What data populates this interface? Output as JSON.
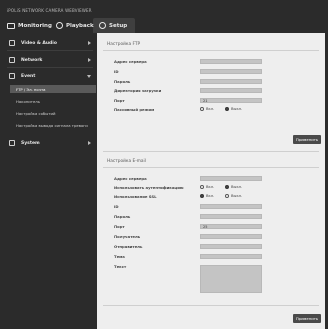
{
  "brand": "iPOLiS NETWORK CAMERA WEBVIEWER",
  "topnav": {
    "monitoring": "Monitoring",
    "playback": "Playback",
    "setup": "Setup"
  },
  "sidebar": {
    "items": [
      {
        "label": "Video & Audio"
      },
      {
        "label": "Network"
      },
      {
        "label": "Event"
      },
      {
        "label": "System"
      }
    ],
    "event_sub": [
      {
        "label": "FTP / Эл. почта"
      },
      {
        "label": "Накопитель"
      },
      {
        "label": "Настройка событий"
      },
      {
        "label": "Настройка вывода сигнала тревоги"
      }
    ]
  },
  "ftp": {
    "title": "Настройка FTP",
    "fields": [
      {
        "label": "Адрес сервера"
      },
      {
        "label": "ID"
      },
      {
        "label": "Пароль"
      },
      {
        "label": "Директория загрузки"
      },
      {
        "label": "Порт"
      }
    ],
    "port_value": "21",
    "passive_label": "Пассивный режим",
    "on_label": "Вкл.",
    "off_label": "Выкл.",
    "passive_selected": "off",
    "apply": "Применить"
  },
  "email": {
    "title": "Настройка E-mail",
    "server_label": "Адрес сервера",
    "auth_label": "Использовать аутентификацию",
    "ssl_label": "Использование SSL",
    "on_label": "Вкл.",
    "off_label": "Выкл.",
    "auth_selected": "off",
    "ssl_selected": "on",
    "id_label": "ID",
    "password_label": "Пароль",
    "port_label": "Порт",
    "port_value": "25",
    "recipient_label": "Получатель",
    "sender_label": "Отправитель",
    "subject_label": "Тема",
    "body_label": "Текст",
    "apply": "Применить"
  }
}
